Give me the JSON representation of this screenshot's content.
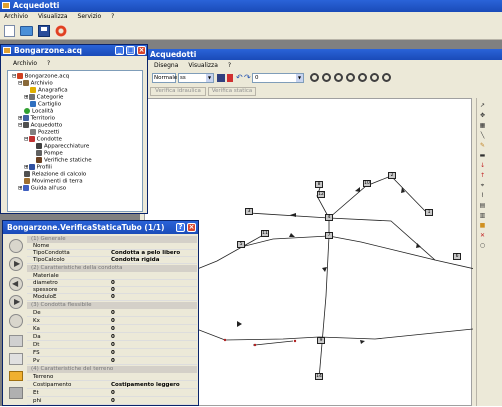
{
  "app": {
    "title": "Acquedotti",
    "menu": [
      "Archivio",
      "Visualizza",
      "Servizio",
      "?"
    ]
  },
  "main_window": {
    "title": "Acquedotti",
    "menu": [
      "Disegna",
      "Visualizza",
      "?"
    ],
    "toolbar": {
      "zoom_value": "ss",
      "style_value": "Normale",
      "number_value": "0"
    },
    "tabs": [
      "Verifica idraulica",
      "Verifica statica"
    ]
  },
  "tree_window": {
    "title": "Bongarzone.acq",
    "menu": [
      "Archivio",
      "?"
    ],
    "items": [
      {
        "label": "Bongarzone.acq",
        "icon": "project-icon",
        "color": "#d04020"
      },
      {
        "label": "Archivio",
        "icon": "archive-icon",
        "color": "#8a6a3a"
      },
      {
        "label": "Anagrafica",
        "icon": "warning-icon",
        "color": "#e0b000"
      },
      {
        "label": "Categorie",
        "icon": "gear-icon",
        "color": "#707070"
      },
      {
        "label": "Cartiglio",
        "icon": "document-icon",
        "color": "#3070c0"
      },
      {
        "label": "Località",
        "icon": "globe-icon",
        "color": "#30a030"
      },
      {
        "label": "Territorio",
        "icon": "terrain-icon",
        "color": "#4060a0"
      },
      {
        "label": "Acquedotto",
        "icon": "network-icon",
        "color": "#505050"
      },
      {
        "label": "Pozzetti",
        "icon": "manhole-icon",
        "color": "#808080"
      },
      {
        "label": "Condotte",
        "icon": "pipe-icon",
        "color": "#c03030"
      },
      {
        "label": "Apparecchiature",
        "icon": "device-icon",
        "color": "#404040"
      },
      {
        "label": "Pompe",
        "icon": "pump-icon",
        "color": "#606060"
      },
      {
        "label": "Verifiche statiche",
        "icon": "check-icon",
        "color": "#6a4020"
      },
      {
        "label": "Profili",
        "icon": "profile-icon",
        "color": "#3050a0"
      },
      {
        "label": "Relazione di calcolo",
        "icon": "report-icon",
        "color": "#505050"
      },
      {
        "label": "Movimenti di terra",
        "icon": "earth-icon",
        "color": "#a07030"
      },
      {
        "label": "Guida all'uso",
        "icon": "help-icon",
        "color": "#4060c0"
      }
    ]
  },
  "props_window": {
    "title": "Bongarzone.VerificaStaticaTubo (1/1)",
    "sections": {
      "s1": "(1) Generale",
      "s2": "(2) Caratteristiche della condotta",
      "s3": "(3) Condotta flessibile",
      "s4": "(4) Caratteristiche del terreno"
    },
    "rows": {
      "nome": {
        "k": "Nome",
        "v": ""
      },
      "tipocondotta": {
        "k": "TipoCondotta",
        "v": "Condotta a pelo libero"
      },
      "tipocalcolo": {
        "k": "TipoCalcolo",
        "v": "Condotta rigida"
      },
      "materiale": {
        "k": "Materiale",
        "v": ""
      },
      "diametro": {
        "k": "diametro",
        "v": "0"
      },
      "spessore": {
        "k": "spessore",
        "v": "0"
      },
      "modulo": {
        "k": "ModuloE",
        "v": "0"
      },
      "de": {
        "k": "De",
        "v": "0"
      },
      "kx": {
        "k": "Kx",
        "v": "0"
      },
      "ka": {
        "k": "Ka",
        "v": "0"
      },
      "da": {
        "k": "Da",
        "v": "0"
      },
      "dt": {
        "k": "Dt",
        "v": "0"
      },
      "fs": {
        "k": "FS",
        "v": "0"
      },
      "pv": {
        "k": "Pv",
        "v": "0"
      },
      "terreno": {
        "k": "Terreno",
        "v": ""
      },
      "costipamento": {
        "k": "Costipamento",
        "v": "Costipamento leggero"
      },
      "et": {
        "k": "Et",
        "v": "0"
      },
      "phi": {
        "k": "phi",
        "v": "0"
      },
      "gamma": {
        "k": "gamma",
        "v": "0"
      }
    }
  },
  "canvas": {
    "nodes": [
      "1",
      "2",
      "3",
      "4",
      "5",
      "6",
      "7",
      "8",
      "9",
      "10",
      "11",
      "12",
      "14"
    ]
  }
}
